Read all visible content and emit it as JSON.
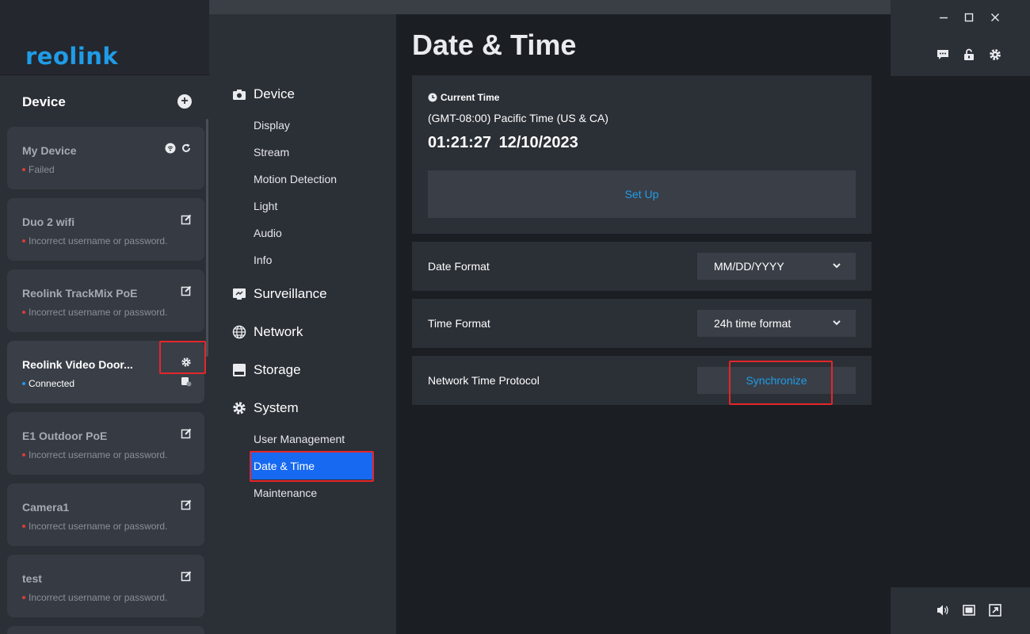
{
  "app": {
    "logo_text": "reolink"
  },
  "sidebar": {
    "title": "Device",
    "devices": [
      {
        "name": "My Device",
        "status": "Failed"
      },
      {
        "name": "Duo 2 wifi",
        "status": "Incorrect username or password."
      },
      {
        "name": "Reolink TrackMix PoE",
        "status": "Incorrect username or password."
      },
      {
        "name": "Reolink Video Door...",
        "status": "Connected"
      },
      {
        "name": "E1 Outdoor PoE",
        "status": "Incorrect username or password."
      },
      {
        "name": "Camera1",
        "status": "Incorrect username or password."
      },
      {
        "name": "test",
        "status": "Incorrect username or password."
      }
    ]
  },
  "nav": {
    "sections": [
      {
        "label": "Device",
        "icon": "camera-icon",
        "items": [
          "Display",
          "Stream",
          "Motion Detection",
          "Light",
          "Audio",
          "Info"
        ]
      },
      {
        "label": "Surveillance",
        "icon": "monitor-icon",
        "items": []
      },
      {
        "label": "Network",
        "icon": "globe-icon",
        "items": []
      },
      {
        "label": "Storage",
        "icon": "storage-icon",
        "items": []
      },
      {
        "label": "System",
        "icon": "gear-icon",
        "items": [
          "User Management",
          "Date & Time",
          "Maintenance"
        ]
      }
    ],
    "selected": "Date & Time"
  },
  "main": {
    "title": "Date & Time",
    "current_time_label": "Current Time",
    "timezone": "(GMT-08:00) Pacific Time (US & CA)",
    "time": "01:21:27",
    "date": "12/10/2023",
    "setup_label": "Set Up",
    "date_format_label": "Date Format",
    "date_format_value": "MM/DD/YYYY",
    "time_format_label": "Time Format",
    "time_format_value": "24h time format",
    "ntp_label": "Network Time Protocol",
    "sync_label": "Synchronize"
  },
  "colors": {
    "accent_blue": "#1f9ce8",
    "selected_nav": "#1669f0",
    "error_red": "#e03a3a",
    "highlight_red": "#e5262a"
  }
}
